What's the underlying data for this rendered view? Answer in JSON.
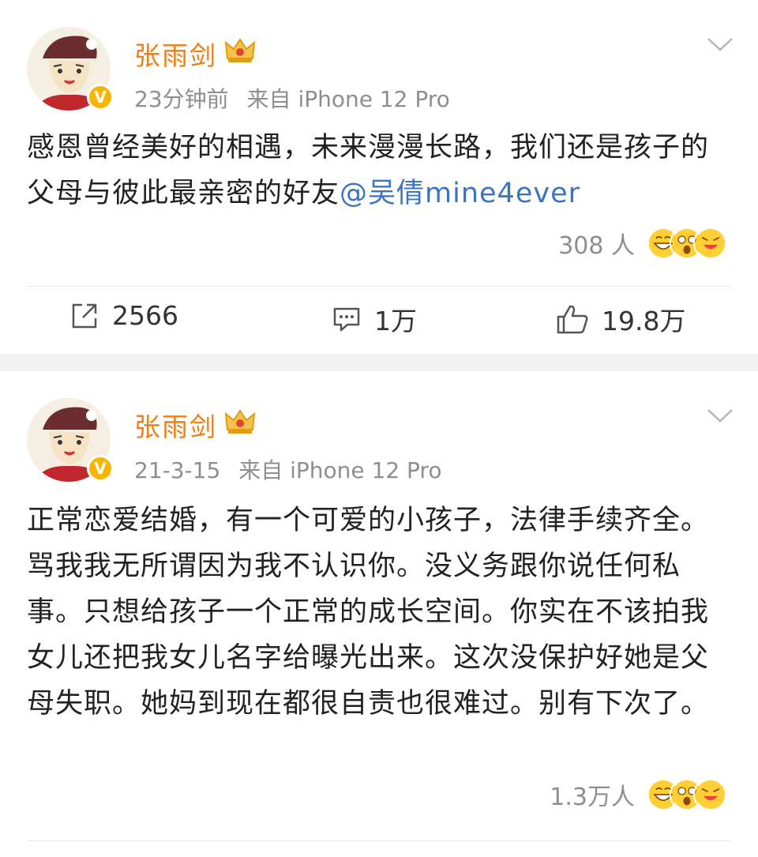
{
  "posts": [
    {
      "user": "张雨剑",
      "time": "23分钟前",
      "source": "来自 iPhone 12 Pro",
      "text": "感恩曾经美好的相遇，未来漫漫长路，我们还是孩子的父母与彼此最亲密的好友",
      "mention": "@吴倩mine4ever",
      "reactions": "308 人",
      "actions": {
        "repost": "2566",
        "comment": "1万",
        "like": "19.8万"
      }
    },
    {
      "user": "张雨剑",
      "time": "21-3-15",
      "source": "来自 iPhone 12 Pro",
      "text": "正常恋爱结婚，有一个可爱的小孩子，法律手续齐全。骂我我无所谓因为我不认识你。没义务跟你说任何私事。只想给孩子一个正常的成长空间。你实在不该拍我女儿还把我女儿名字给曝光出来。这次没保护好她是父母失职。她妈到现在都很自责也很难过。别有下次了。",
      "reactions": "1.3万人"
    }
  ],
  "icons": {
    "verified": "v-badge-icon",
    "vip": "crown-icon",
    "menu": "chevron-down-icon",
    "repost": "share-icon",
    "comment": "comment-icon",
    "like": "thumbs-up-icon"
  },
  "colors": {
    "username": "#f07b13",
    "mention": "#3b74c4",
    "meta": "#8e8e8e",
    "verified": "#f7b500"
  }
}
